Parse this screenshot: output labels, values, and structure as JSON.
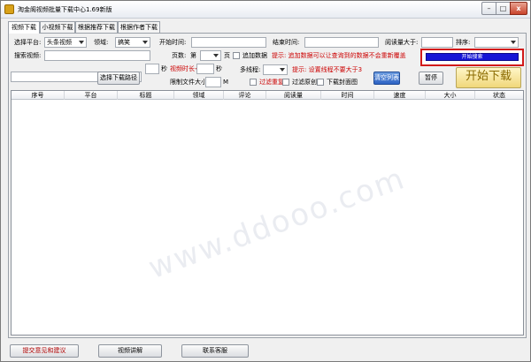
{
  "window": {
    "title": "淘金阁视频批量下载中心1.69新版",
    "min_label": "–",
    "max_label": "□",
    "close_label": "x"
  },
  "tabs": [
    {
      "label": "视频下载"
    },
    {
      "label": "小视频下载"
    },
    {
      "label": "根据推荐下载"
    },
    {
      "label": "根据作者下载"
    }
  ],
  "form": {
    "platform_label": "选择平台:",
    "platform_value": "头条视频",
    "category_label": "领域:",
    "category_value": "搞笑",
    "start_time_label": "开始时间:",
    "start_time_value": "",
    "end_time_label": "结束时间:",
    "end_time_value": "",
    "views_gt_label": "阅读量大于:",
    "views_gt_value": "",
    "sort_label": "排序:",
    "sort_value": "",
    "search_label": "搜索视频:",
    "search_value": "",
    "pages_label": "页数:",
    "page_prefix": "第",
    "page_value": "",
    "page_suffix": "页",
    "append_label": "追加数据",
    "hint_append": "提示: 追加数据可以让查询到的数据不会重新覆盖",
    "progress_label": "开始搜索",
    "progress_value": 1.0,
    "path_value": "",
    "choose_path_button": "选择下载路径",
    "seconds_label": "秒",
    "duration_value": "",
    "duration_label": "视频时长<",
    "duration_suffix": "秒",
    "size_limit_label": "限制文件大小:",
    "size_unit": "M",
    "threads_label": "多线程:",
    "threads_value": "",
    "hint_threads": "提示: 设置线程不要大于3",
    "dedupe_label": "过滤重复",
    "original_label": "过滤原创",
    "cover_label": "下载封面图",
    "clear_button": "清空列表",
    "pause_button": "暂停",
    "start_button": "开始下载"
  },
  "grid": {
    "columns": [
      "序号",
      "平台",
      "标题",
      "领域",
      "评论",
      "阅读量",
      "时间",
      "速度",
      "大小",
      "状态"
    ]
  },
  "footer": {
    "feedback_button": "提交意见和建议",
    "tutorial_button": "视频讲解",
    "support_button": "联系客服"
  },
  "watermark": "www.ddooo.com"
}
